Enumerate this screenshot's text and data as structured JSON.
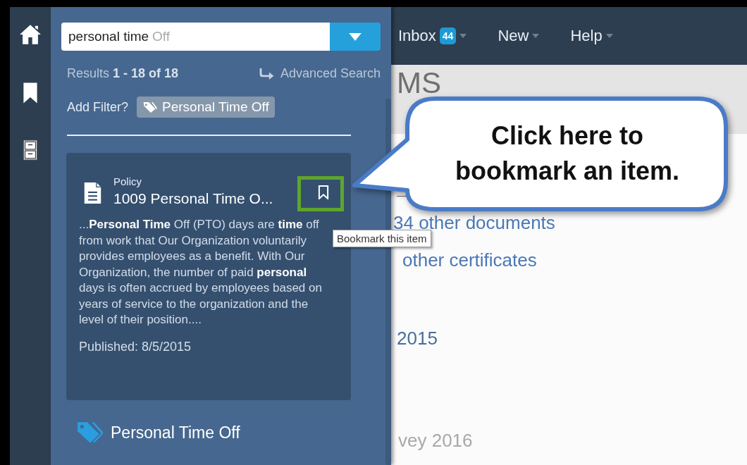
{
  "search": {
    "value": "personal time",
    "suggestion": "Off"
  },
  "results": {
    "summary": "Results **1 - 18 of 18**",
    "advanced_search": "Advanced Search"
  },
  "filter": {
    "label": "Add Filter?",
    "tag": "Personal Time Off"
  },
  "result_card": {
    "type": "Policy",
    "title": "1009 Personal Time O...",
    "bookmarked": false,
    "excerpt": "...**Personal Time** Off (PTO) days are **time** off from work that Our Organization voluntarily provides employees as a benefit. With Our Organization, the number of paid **personal** days is often accrued by employees based on years of service to the organization and the level of their position....",
    "published": "Published: 8/5/2015"
  },
  "tag_result": {
    "label": "Personal Time Off"
  },
  "nav": [
    {
      "label": "Inbox",
      "badge": "44"
    },
    {
      "label": "New"
    },
    {
      "label": "Help"
    }
  ],
  "main": {
    "heading": "MS",
    "links": [
      "34 other documents",
      "other certificates"
    ],
    "date": "2015",
    "faded": "vey 2016"
  },
  "tooltip": "Bookmark this item",
  "callout": "Click here to bookmark an item."
}
